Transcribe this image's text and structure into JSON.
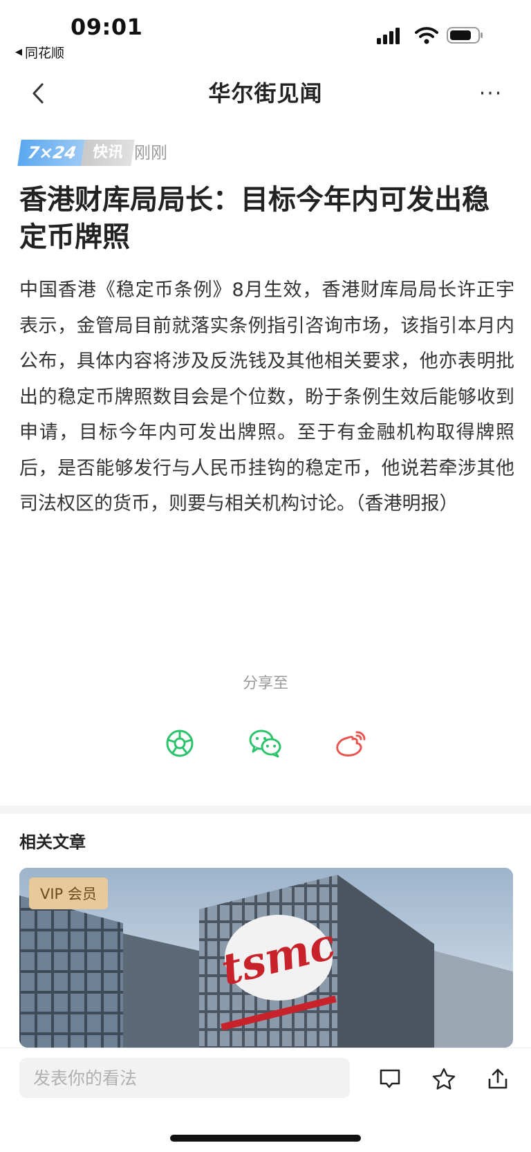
{
  "status_bar": {
    "time": "09:01",
    "back_app_label": "同花顺",
    "icons": [
      "signal-icon",
      "wifi-icon",
      "battery-icon"
    ]
  },
  "nav": {
    "title": "华尔街见闻",
    "back_icon": "chevron-left-icon",
    "more_icon": "more-dots-icon"
  },
  "article": {
    "badge_724": "7×24",
    "badge_kuaixun": "快讯",
    "time_ago": "刚刚",
    "headline": "香港财库局局长：目标今年内可发出稳定币牌照",
    "body": "中国香港《稳定币条例》8月生效，香港财库局局长许正宇表示，金管局目前就落实条例指引咨询市场，该指引本月内公布，具体内容将涉及反洗钱及其他相关要求，他亦表明批出的稳定币牌照数目会是个位数，盼于条例生效后能够收到申请，目标今年内可发出牌照。至于有金融机构取得牌照后，是否能够发行与人民币挂钩的稳定币，他说若牵涉其他司法权区的货币，则要与相关机构讨论。（香港明报）"
  },
  "share": {
    "label": "分享至",
    "targets": [
      {
        "name": "moments",
        "icon": "moments-icon",
        "color": "#2bc36b"
      },
      {
        "name": "wechat",
        "icon": "wechat-icon",
        "color": "#2bc36b"
      },
      {
        "name": "weibo",
        "icon": "weibo-icon",
        "color": "#e8544e"
      }
    ]
  },
  "related": {
    "title": "相关文章",
    "card_badge": "VIP 会员",
    "card_image_text": "tsmc"
  },
  "bottom_bar": {
    "comment_placeholder": "发表你的看法",
    "icons": [
      "comment-icon",
      "star-icon",
      "share-icon"
    ]
  },
  "colors": {
    "accent_blue": "#5aa8f0",
    "share_green": "#2bc36b",
    "weibo_red": "#e8544e",
    "vip_gold": "#e7c99a"
  }
}
